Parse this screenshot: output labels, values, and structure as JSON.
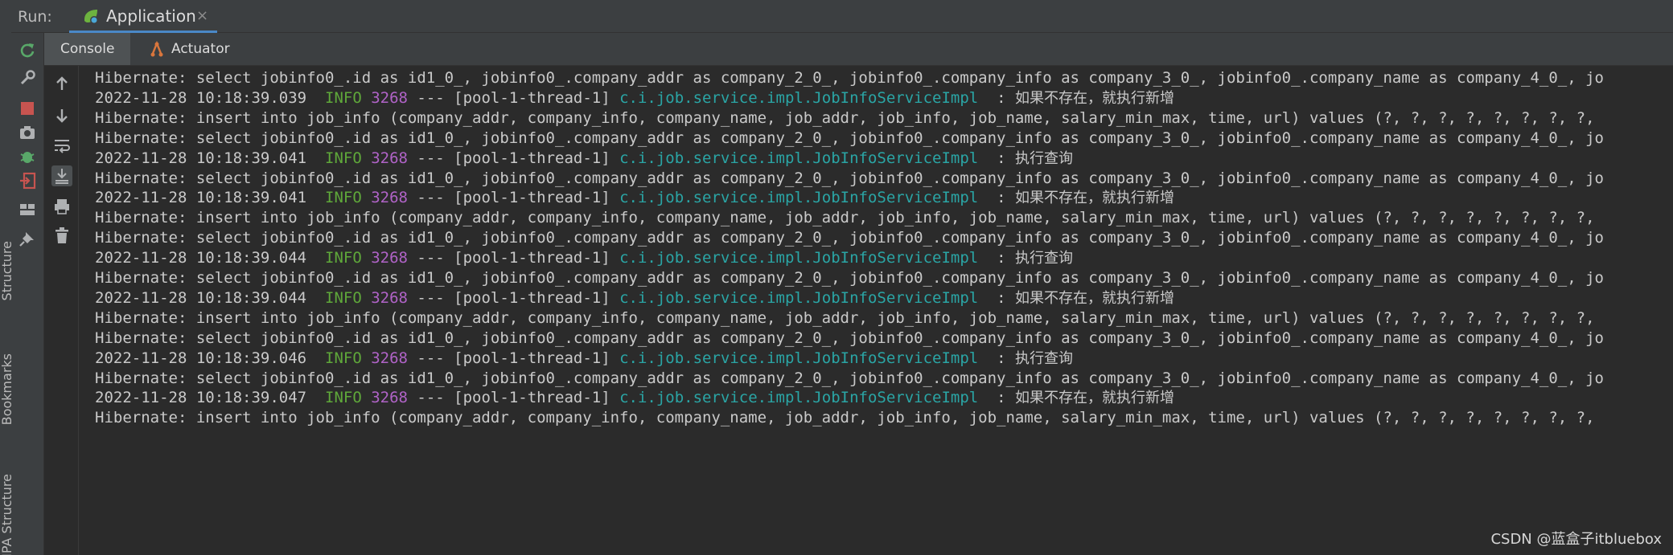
{
  "side_tabs": [
    "Structure",
    "Bookmarks",
    "JPA Structure"
  ],
  "run": {
    "label": "Run:",
    "tab_title": "Application"
  },
  "sub_tabs": {
    "console": "Console",
    "actuator": "Actuator"
  },
  "colors": {
    "background": "#2b2b2b",
    "panel": "#3c3f41",
    "info": "#5fa83a",
    "pid": "#b063c7",
    "logger": "#2aa5a5",
    "accent": "#4a88c7"
  },
  "left_toolbar_icons": [
    "rerun-icon",
    "wrench-icon",
    "stop-icon",
    "camera-icon",
    "debug-icon",
    "exit-icon",
    "layout-icon",
    "pin-icon"
  ],
  "console_toolbar_icons": [
    "arrow-up-icon",
    "arrow-down-icon",
    "soft-wrap-icon",
    "scroll-to-end-icon",
    "print-icon",
    "trash-icon"
  ],
  "console": {
    "lines": [
      {
        "type": "sql",
        "text": "Hibernate: select jobinfo0_.id as id1_0_, jobinfo0_.company_addr as company_2_0_, jobinfo0_.company_info as company_3_0_, jobinfo0_.company_name as company_4_0_, jo"
      },
      {
        "type": "log",
        "ts": "2022-11-28 10:18:39.039",
        "level": "INFO",
        "pid": "3268",
        "thread": " --- [pool-1-thread-1] ",
        "logger": "c.i.job.service.impl.JobInfoServiceImpl",
        "sep": "  : ",
        "msg": "如果不存在，就执行新增"
      },
      {
        "type": "sql",
        "text": "Hibernate: insert into job_info (company_addr, company_info, company_name, job_addr, job_info, job_name, salary_min_max, time, url) values (?, ?, ?, ?, ?, ?, ?, ?,"
      },
      {
        "type": "sql",
        "text": "Hibernate: select jobinfo0_.id as id1_0_, jobinfo0_.company_addr as company_2_0_, jobinfo0_.company_info as company_3_0_, jobinfo0_.company_name as company_4_0_, jo"
      },
      {
        "type": "log",
        "ts": "2022-11-28 10:18:39.041",
        "level": "INFO",
        "pid": "3268",
        "thread": " --- [pool-1-thread-1] ",
        "logger": "c.i.job.service.impl.JobInfoServiceImpl",
        "sep": "  : ",
        "msg": "执行查询"
      },
      {
        "type": "sql",
        "text": "Hibernate: select jobinfo0_.id as id1_0_, jobinfo0_.company_addr as company_2_0_, jobinfo0_.company_info as company_3_0_, jobinfo0_.company_name as company_4_0_, jo"
      },
      {
        "type": "log",
        "ts": "2022-11-28 10:18:39.041",
        "level": "INFO",
        "pid": "3268",
        "thread": " --- [pool-1-thread-1] ",
        "logger": "c.i.job.service.impl.JobInfoServiceImpl",
        "sep": "  : ",
        "msg": "如果不存在，就执行新增"
      },
      {
        "type": "sql",
        "text": "Hibernate: insert into job_info (company_addr, company_info, company_name, job_addr, job_info, job_name, salary_min_max, time, url) values (?, ?, ?, ?, ?, ?, ?, ?,"
      },
      {
        "type": "sql",
        "text": "Hibernate: select jobinfo0_.id as id1_0_, jobinfo0_.company_addr as company_2_0_, jobinfo0_.company_info as company_3_0_, jobinfo0_.company_name as company_4_0_, jo"
      },
      {
        "type": "log",
        "ts": "2022-11-28 10:18:39.044",
        "level": "INFO",
        "pid": "3268",
        "thread": " --- [pool-1-thread-1] ",
        "logger": "c.i.job.service.impl.JobInfoServiceImpl",
        "sep": "  : ",
        "msg": "执行查询"
      },
      {
        "type": "sql",
        "text": "Hibernate: select jobinfo0_.id as id1_0_, jobinfo0_.company_addr as company_2_0_, jobinfo0_.company_info as company_3_0_, jobinfo0_.company_name as company_4_0_, jo"
      },
      {
        "type": "log",
        "ts": "2022-11-28 10:18:39.044",
        "level": "INFO",
        "pid": "3268",
        "thread": " --- [pool-1-thread-1] ",
        "logger": "c.i.job.service.impl.JobInfoServiceImpl",
        "sep": "  : ",
        "msg": "如果不存在，就执行新增"
      },
      {
        "type": "sql",
        "text": "Hibernate: insert into job_info (company_addr, company_info, company_name, job_addr, job_info, job_name, salary_min_max, time, url) values (?, ?, ?, ?, ?, ?, ?, ?,"
      },
      {
        "type": "sql",
        "text": "Hibernate: select jobinfo0_.id as id1_0_, jobinfo0_.company_addr as company_2_0_, jobinfo0_.company_info as company_3_0_, jobinfo0_.company_name as company_4_0_, jo"
      },
      {
        "type": "log",
        "ts": "2022-11-28 10:18:39.046",
        "level": "INFO",
        "pid": "3268",
        "thread": " --- [pool-1-thread-1] ",
        "logger": "c.i.job.service.impl.JobInfoServiceImpl",
        "sep": "  : ",
        "msg": "执行查询"
      },
      {
        "type": "sql",
        "text": "Hibernate: select jobinfo0_.id as id1_0_, jobinfo0_.company_addr as company_2_0_, jobinfo0_.company_info as company_3_0_, jobinfo0_.company_name as company_4_0_, jo"
      },
      {
        "type": "log",
        "ts": "2022-11-28 10:18:39.047",
        "level": "INFO",
        "pid": "3268",
        "thread": " --- [pool-1-thread-1] ",
        "logger": "c.i.job.service.impl.JobInfoServiceImpl",
        "sep": "  : ",
        "msg": "如果不存在，就执行新增"
      },
      {
        "type": "sql",
        "text": "Hibernate: insert into job_info (company_addr, company_info, company_name, job_addr, job_info, job_name, salary_min_max, time, url) values (?, ?, ?, ?, ?, ?, ?, ?,"
      }
    ]
  },
  "watermark": "CSDN @蓝盒子itbluebox"
}
